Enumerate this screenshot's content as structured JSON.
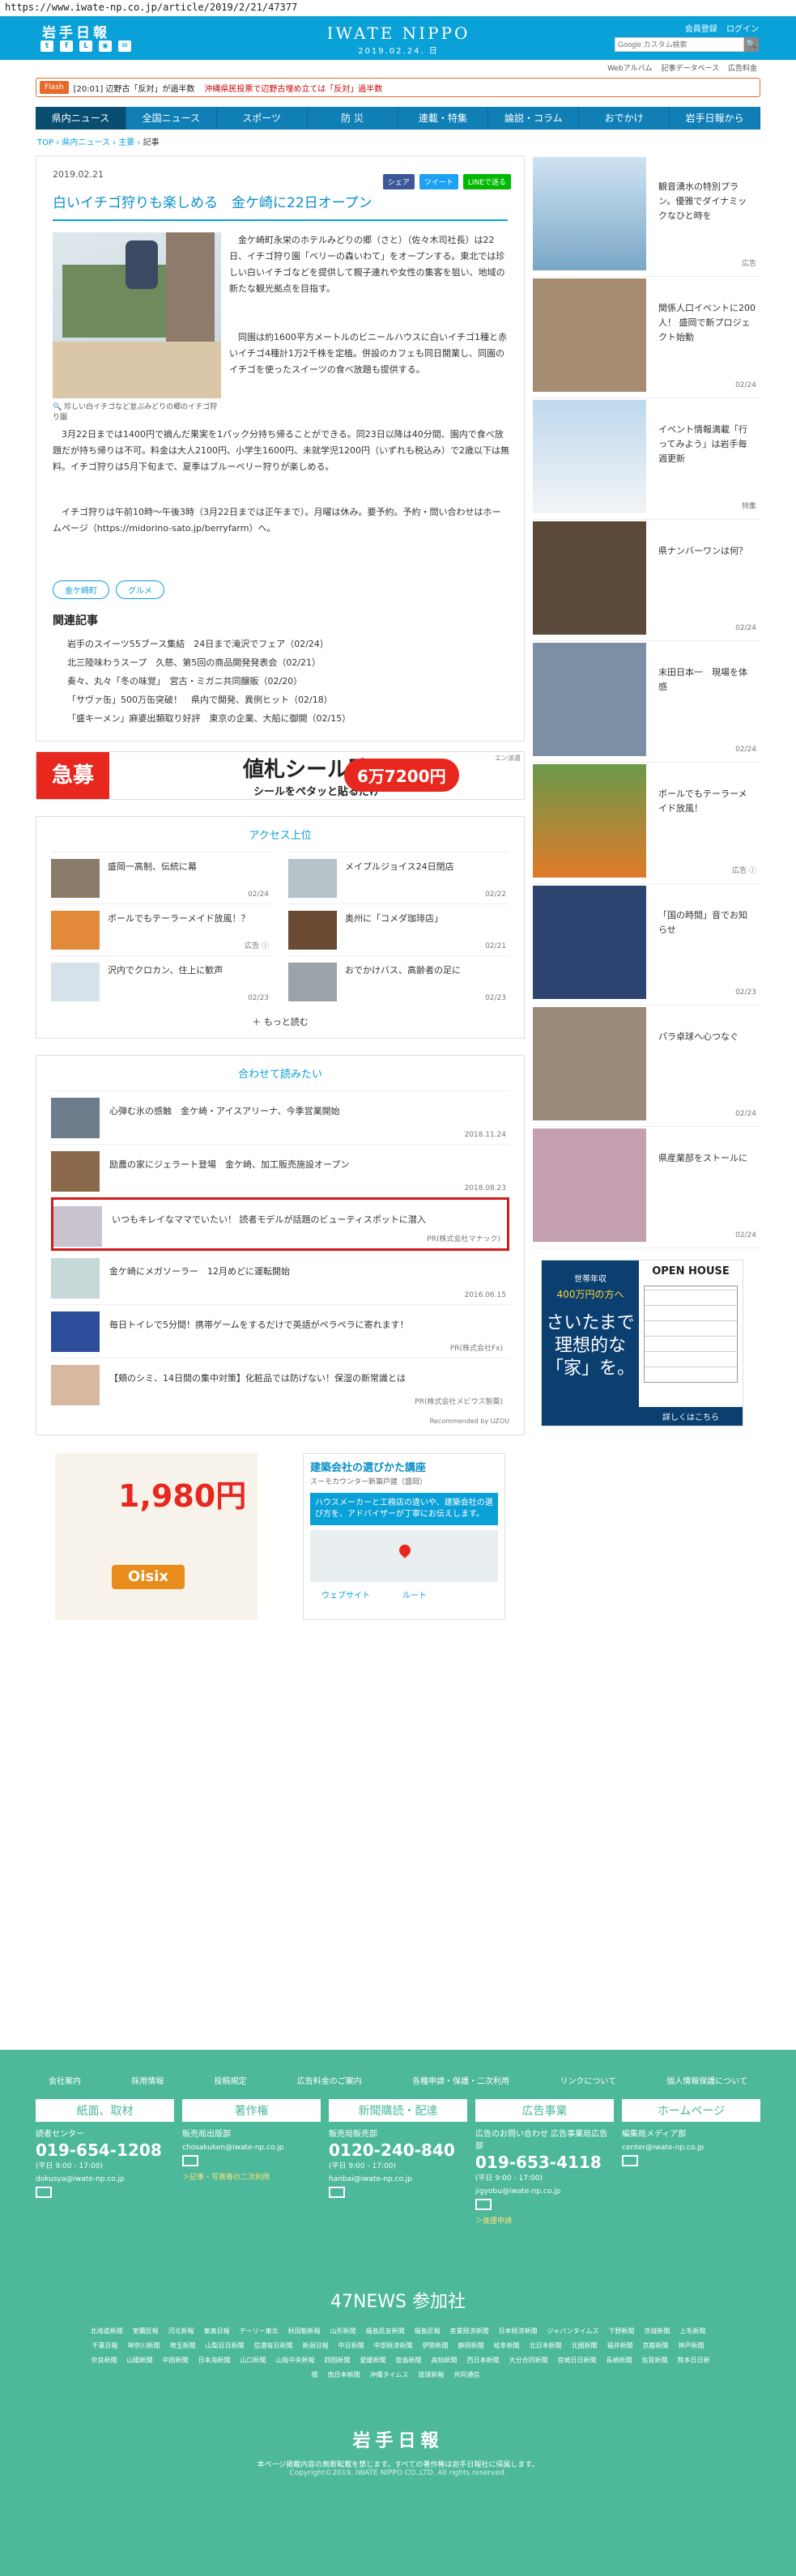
{
  "url": "https://www.iwate-np.co.jp/article/2019/2/21/47377",
  "header": {
    "logo_left": "岩手日報",
    "brand": "IWATE NIPPO",
    "date": "2019.02.24. 日",
    "register": "会員登録",
    "login": "ログイン",
    "search_placeholder": "Google カスタム検索",
    "search_btn": "🔍",
    "icons": [
      "twitter-icon",
      "facebook-icon",
      "line-icon",
      "rss-icon",
      "mail-icon"
    ]
  },
  "subbar": {
    "items": [
      "Webアルバム",
      "記事データベース",
      "広告料金"
    ]
  },
  "flash": {
    "tag": "Flash",
    "t1": "[20:01] 辺野古「反対」が過半数",
    "t2": "沖縄県民投票で辺野古埋め立ては「反対」過半数"
  },
  "nav": {
    "items": [
      "県内ニュース",
      "全国ニュース",
      "スポーツ",
      "防 災",
      "連載・特集",
      "論説・コラム",
      "おでかけ",
      "岩手日報から"
    ]
  },
  "crumbs": {
    "top": "TOP",
    "cat": "県内ニュース",
    "sub": "主要",
    "cur": "記事"
  },
  "article": {
    "date": "2019.02.21",
    "share": [
      "シェア",
      "ツイート",
      "LINEで送る"
    ],
    "title": "白いイチゴ狩りも楽しめる　金ケ崎に22日オープン",
    "caption": "🔍 珍しい白イチゴなど並ぶみどりの郷のイチゴ狩り園",
    "p1": "　金ケ崎町永栄のホテルみどりの郷（さと）（佐々木司社長）は22日、イチゴ狩り園「ベリーの森いわて」をオープンする。東北では珍しい白いイチゴなどを提供して親子連れや女性の集客を狙い、地域の新たな観光拠点を目指す。",
    "p2": "　同園は約1600平方メートルのビニールハウスに白いイチゴ1種と赤いイチゴ4種計1万2千株を定植。併設のカフェも同日開業し、同園のイチゴを使ったスイーツの食べ放題も提供する。",
    "p3": "　3月22日までは1400円で摘んだ果実を1パック分持ち帰ることができる。同23日以降は40分間、園内で食べ放題だが持ち帰りは不可。料金は大人2100円、小学生1600円、未就学児1200円（いずれも税込み）で2歳以下は無料。イチゴ狩りは5月下旬まで、夏季はブルーベリー狩りが楽しめる。",
    "p4": "　イチゴ狩りは午前10時〜午後3時（3月22日までは正午まで）。月曜は休み。要予約。予約・問い合わせはホームページ（https://midorino-sato.jp/berryfarm）へ。",
    "tags": [
      "金ケ崎町",
      "グルメ"
    ],
    "related_h": "関連記事",
    "related": [
      "岩手のスイーツ55ブース集結　24日まで滝沢でフェア（02/24）",
      "北三陸味わうスープ　久慈、第5回の商品開発発表会（02/21）",
      "奏々、丸々「冬の味覚」　宮古・ミガニ共同醸販（02/20）",
      "「サヴァ缶」500万缶突破！　県内で開発、異例ヒット（02/18）",
      "「盛キーメン」麻婆出類取り好評　東京の企業、大船に御開（02/15）"
    ]
  },
  "ad_banner": {
    "red": "急募",
    "a": "値札シール貼り",
    "b": "シールをペタッと貼るだけ",
    "price": "6万7200円",
    "corner": "エン派遣"
  },
  "access": {
    "heading": "アクセス上位",
    "items": [
      {
        "text": "盛岡一高制、伝統に幕",
        "date": "02/24"
      },
      {
        "text": "メイプルジョイス24日閉店",
        "date": "02/22"
      },
      {
        "text": "ボールでもテーラーメイド放風！？",
        "date": "広告 ⓘ"
      },
      {
        "text": "奥州に「コメダ珈琲店」",
        "date": "02/21"
      },
      {
        "text": "沢内でクロカン、住上に歓声",
        "date": "02/23"
      },
      {
        "text": "おでかけバス、高齢者の足に",
        "date": "02/23"
      }
    ],
    "more": "＋ もっと読む"
  },
  "recommend": {
    "heading": "合わせて読みたい",
    "items": [
      {
        "text": "心弾む氷の感触　金ケ崎・アイスアリーナ、今季営業開始",
        "date": "2018.11.24",
        "pr": ""
      },
      {
        "text": "励農の家にジェラート登場　金ケ崎、加工販売施設オープン",
        "date": "2018.08.23",
        "pr": ""
      },
      {
        "text": "いつもキレイなママでいたい！ 読者モデルが話題のビューティスポットに潜入",
        "date": "",
        "pr": "PR(株式会社マナック)"
      },
      {
        "text": "金ケ崎にメガソーラー　12月めどに運転開始",
        "date": "2016.06.15",
        "pr": ""
      },
      {
        "text": "毎日トイレで5分間！携帯ゲームをするだけで英語がペラペラに寄れます！",
        "date": "",
        "pr": "PR(株式会社Fx)"
      },
      {
        "text": "【頬のシミ、14日間の集中対策】化粧品では防げない！保湿の新常識とは",
        "date": "",
        "pr": "PR(株式会社メビウス製薬)"
      }
    ],
    "powered": "Recommended by UZOU"
  },
  "ad_food": {
    "price": "1,980円",
    "brand": "Oisix"
  },
  "ad_map": {
    "title": "建築会社の選びかた講座",
    "sub": "スーモカウンター新築戸建（盛岡）",
    "body": "ハウスメーカーと工務店の違いや、建築会社の選び方を、アドバイザーが丁寧にお伝えします。",
    "web": "ウェブサイト",
    "route": "ルート"
  },
  "side": {
    "items": [
      {
        "text": "観音湧水の特別プラン。優雅でダイナミックなひと時を",
        "badge": "広告"
      },
      {
        "text": "関係人口イベントに200人！ 盛岡で新プロジェクト始動",
        "badge": "02/24"
      },
      {
        "text": "イベント情報満載「行ってみよう」は岩手毎週更新",
        "badge": "特集"
      },
      {
        "text": "県ナンバーワンは何？",
        "badge": "02/24"
      },
      {
        "text": "末田日本一　現場を体感",
        "badge": "02/24"
      },
      {
        "text": "ボールでもテーラーメイド放風！",
        "badge": "広告 ⓘ"
      },
      {
        "text": "「国の時間」音でお知らせ",
        "badge": "02/23"
      },
      {
        "text": "パラ卓球へ心つなぐ",
        "badge": "02/24"
      },
      {
        "text": "県産業部をストールに",
        "badge": "02/24"
      }
    ],
    "ad": {
      "a": "世帯年収",
      "b": "400万円の方へ",
      "c": "さいたまで理想的な「家」を。",
      "h": "OPEN HOUSE",
      "cta": "詳しくはこちら"
    }
  },
  "footer": {
    "links": [
      "会社案内",
      "採用情報",
      "投稿規定",
      "広告料金のご案内",
      "各種申請・保護・二次利用",
      "リンクについて",
      "個人情報保護について"
    ],
    "cols": [
      {
        "h": "紙面、取材",
        "sub": "読者センター",
        "big": "019-654-1208",
        "sm": "(平日 9:00 - 17:00)",
        "mail": "dokusya@iwate-np.co.jp",
        "lnk": ""
      },
      {
        "h": "著作権",
        "sub": "販売局出版部",
        "big": "",
        "sm": "",
        "mail": "chosakuken@iwate-np.co.jp",
        "lnk": "＞記事・写真等の二次利用"
      },
      {
        "h": "新聞購読・配達",
        "sub": "販売局販売部",
        "big": "0120-240-840",
        "sm": "(平日 9:00 - 17:00)",
        "mail": "hanbai@iwate-np.co.jp",
        "lnk": ""
      },
      {
        "h": "広告事業",
        "sub": "広告のお問い合わせ 広告事業局広告部",
        "big": "019-653-4118",
        "sm": "(平日 9:00 - 17:00)",
        "mail": "jigyobu@iwate-np.co.jp",
        "lnk": "＞後援申請"
      },
      {
        "h": "ホームページ",
        "sub": "編集局メディア部",
        "big": "",
        "sm": "",
        "mail": "center@iwate-np.co.jp",
        "lnk": ""
      }
    ],
    "n47": "47NEWS 参加社",
    "papers": [
      "北海道新聞",
      "室蘭民報",
      "河北新報",
      "東奥日報",
      "デーリー東北",
      "秋田魁新報",
      "山形新聞",
      "福島民友新聞",
      "福島民報",
      "産業経済新聞",
      "日本経済新聞",
      "ジャパンタイムズ",
      "下野新聞",
      "茨城新聞",
      "上毛新聞",
      "千葉日報",
      "神奈川新聞",
      "埼玉新聞",
      "山梨日日新聞",
      "信濃毎日新聞",
      "新潟日報",
      "中日新聞",
      "中部経済新聞",
      "伊勢新聞",
      "静岡新聞",
      "岐阜新聞",
      "北日本新聞",
      "北國新聞",
      "福井新聞",
      "京都新聞",
      "神戸新聞",
      "奈良新聞",
      "山陽新聞",
      "中国新聞",
      "日本海新聞",
      "山口新聞",
      "山陰中央新報",
      "四国新聞",
      "愛媛新聞",
      "徳島新聞",
      "高知新聞",
      "西日本新聞",
      "大分合同新聞",
      "宮崎日日新聞",
      "長崎新聞",
      "佐賀新聞",
      "熊本日日新聞",
      "南日本新聞",
      "沖縄タイムス",
      "琉球新報",
      "共同通信"
    ],
    "logo": "岩手日報",
    "copy": "本ページ掲載内容の無断転載を禁じます。すべての著作権は岩手日報社に帰属します。",
    "copy2": "Copyright©2019, IWATE NIPPO CO.,LTD. All rights reserved."
  },
  "colors": {
    "brand": "#0aa0d8",
    "nav": "#0f7fb6",
    "footer": "#4db89a",
    "highlight": "#d01c1c"
  }
}
